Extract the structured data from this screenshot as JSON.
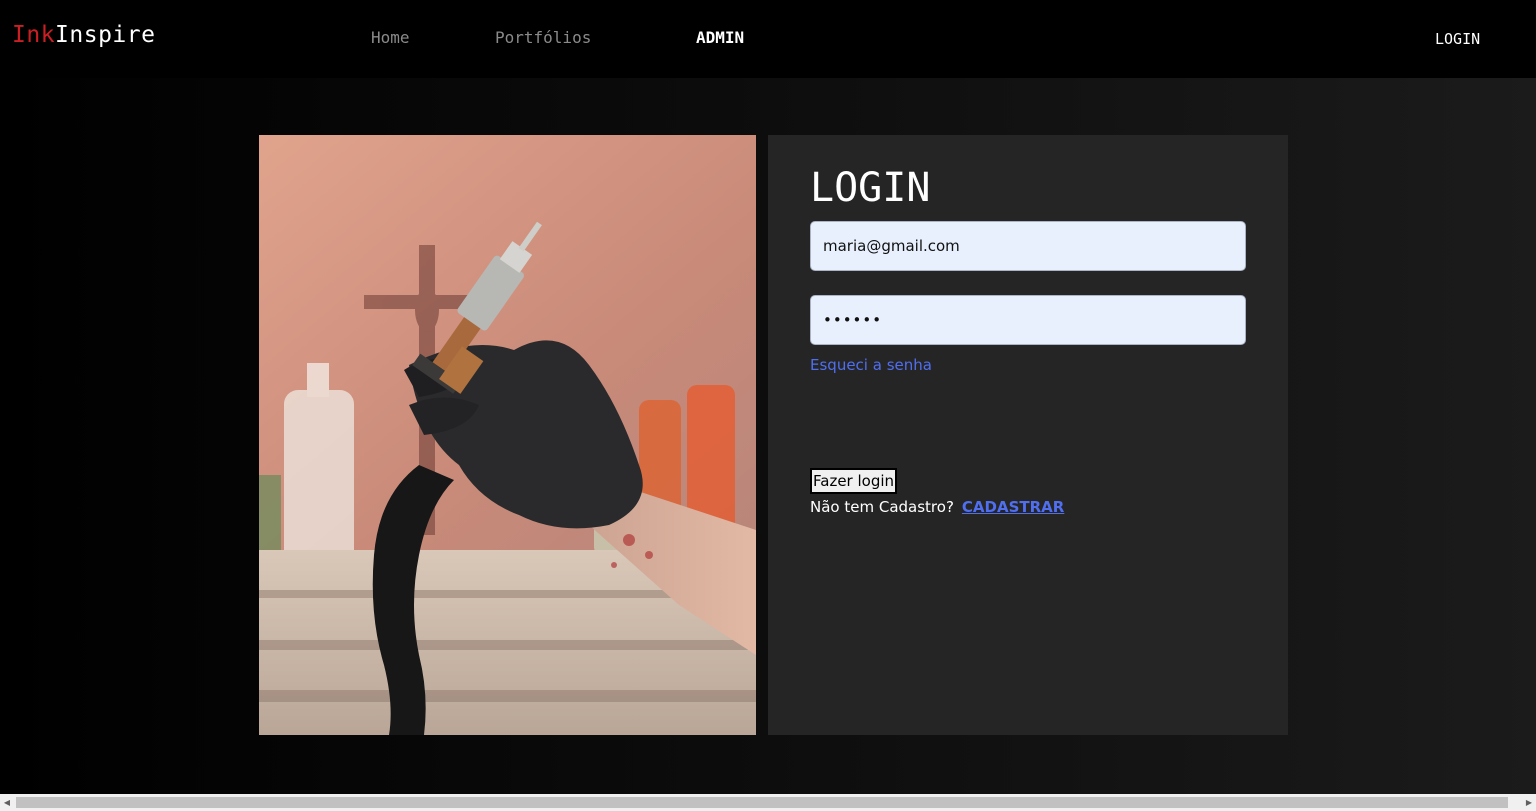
{
  "nav": {
    "brand_part1": "Ink",
    "brand_part2": "Inspire",
    "links": [
      {
        "label": "Home"
      },
      {
        "label": "Portfólios"
      },
      {
        "label": "ADMIN"
      }
    ],
    "login_label": "LOGIN"
  },
  "photo": {
    "subject": "tattoo-artist-hand-holding-machine"
  },
  "login_form": {
    "title": "LOGIN",
    "email_value": "maria@gmail.com",
    "password_value": "••••••",
    "forgot_password_label": "Esqueci a senha",
    "submit_label": "Fazer login",
    "no_account_text": "Não tem Cadastro?",
    "signup_label": "CADASTRAR"
  },
  "scrollbar": {
    "left_arrow": "◀",
    "right_arrow": "▶"
  },
  "colors": {
    "brand_accent": "#cc1f24",
    "link": "#4f6ff0",
    "card_background": "#262526",
    "input_background": "#e8f0fe"
  }
}
